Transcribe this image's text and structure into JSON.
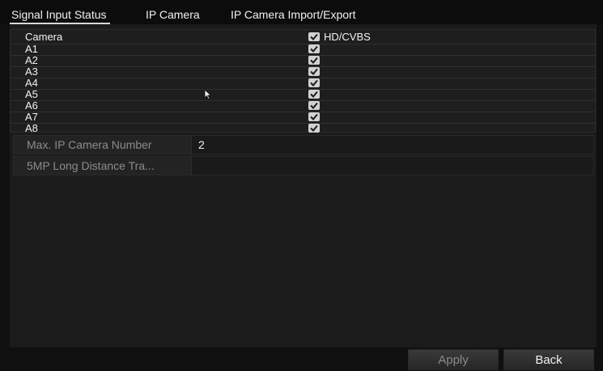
{
  "tabs": [
    {
      "label": "Signal Input Status",
      "active": true
    },
    {
      "label": "IP Camera",
      "active": false
    },
    {
      "label": "IP Camera Import/Export",
      "active": false
    }
  ],
  "signal_table": {
    "header": {
      "camera_label": "Camera",
      "type_label": "HD/CVBS",
      "type_checked": true
    },
    "rows": [
      {
        "camera": "A1",
        "hd_cvbs": true
      },
      {
        "camera": "A2",
        "hd_cvbs": true
      },
      {
        "camera": "A3",
        "hd_cvbs": true
      },
      {
        "camera": "A4",
        "hd_cvbs": true
      },
      {
        "camera": "A5",
        "hd_cvbs": true
      },
      {
        "camera": "A6",
        "hd_cvbs": true
      },
      {
        "camera": "A7",
        "hd_cvbs": true
      },
      {
        "camera": "A8",
        "hd_cvbs": true
      }
    ]
  },
  "settings": {
    "max_ip_camera": {
      "label": "Max. IP Camera Number",
      "value": "2"
    },
    "long_distance": {
      "label": "5MP Long Distance Tra...",
      "value": ""
    }
  },
  "buttons": {
    "apply": "Apply",
    "back": "Back"
  },
  "colors": {
    "background": "#101010",
    "panel": "#1b1b1b",
    "checkbox": "#d2d2d2",
    "apply_text": "#8a8a8a",
    "back_text": "#f0f0f0"
  }
}
